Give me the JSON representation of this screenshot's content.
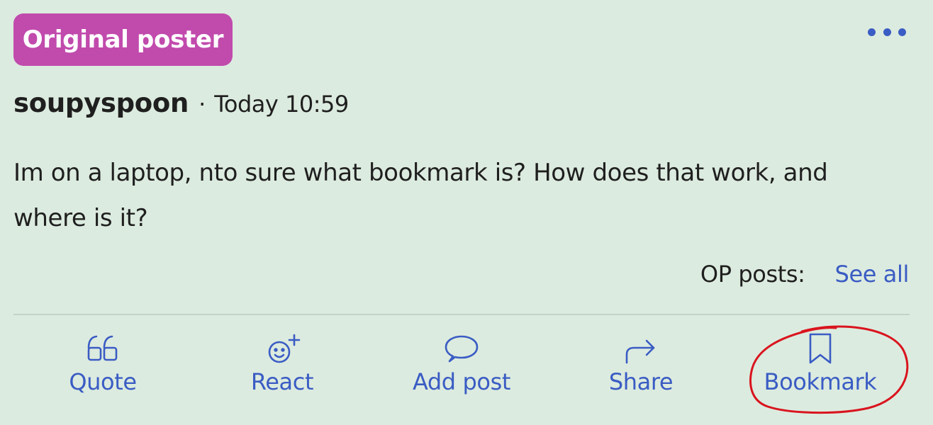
{
  "badge": {
    "label": "Original poster"
  },
  "post": {
    "author": "soupyspoon",
    "separator": "·",
    "time": "Today 10:59",
    "body": "Im on a laptop, nto sure what bookmark is? How does that work, and where is it?"
  },
  "op_posts": {
    "label": "OP posts:",
    "link": "See all"
  },
  "actions": {
    "quote": {
      "label": "Quote",
      "icon": "quote-icon"
    },
    "react": {
      "label": "React",
      "icon": "smiley-plus-icon"
    },
    "add_post": {
      "label": "Add post",
      "icon": "speech-bubble-icon"
    },
    "share": {
      "label": "Share",
      "icon": "share-arrow-icon"
    },
    "bookmark": {
      "label": "Bookmark",
      "icon": "bookmark-icon"
    }
  },
  "colors": {
    "background": "#dcebdf",
    "badge": "#c14aad",
    "accent": "#3a5cc4",
    "annotation": "#d9141e"
  }
}
